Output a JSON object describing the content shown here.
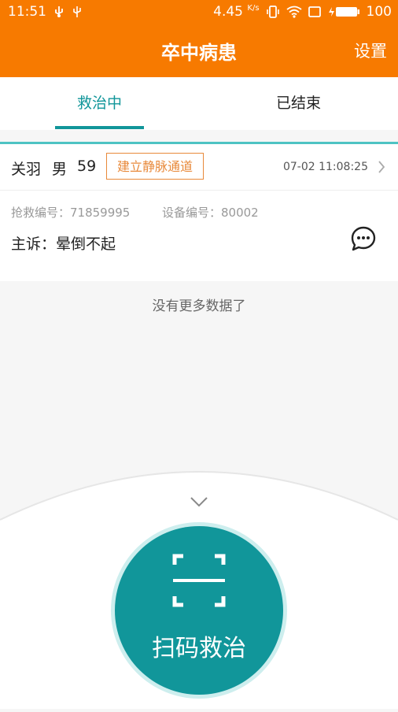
{
  "status_bar": {
    "time": "11:51",
    "speed": "4.45",
    "speed_unit": "K/s",
    "battery": "100"
  },
  "header": {
    "title": "卒中病患",
    "settings_label": "设置"
  },
  "tabs": [
    {
      "label": "救治中",
      "active": true
    },
    {
      "label": "已结束",
      "active": false
    }
  ],
  "patient": {
    "name": "关羽",
    "gender": "男",
    "age": "59",
    "tag": "建立静脉通道",
    "timestamp": "07-02 11:08:25",
    "rescue_no_text": "抢救编号：71859995",
    "device_no_text": "设备编号：80002",
    "complaint_text": "主诉：晕倒不起"
  },
  "list_footer": "没有更多数据了",
  "scan_button": {
    "label": "扫码救治"
  },
  "colors": {
    "brand_orange": "#f77a00",
    "accent_teal": "#11969a",
    "tag_orange": "#e8893a"
  },
  "icons": [
    "usb-icon",
    "vibrate-icon",
    "wifi-icon",
    "battery-icon",
    "chevron-right-icon",
    "message-icon",
    "chevron-down-icon",
    "scan-frame-icon"
  ]
}
